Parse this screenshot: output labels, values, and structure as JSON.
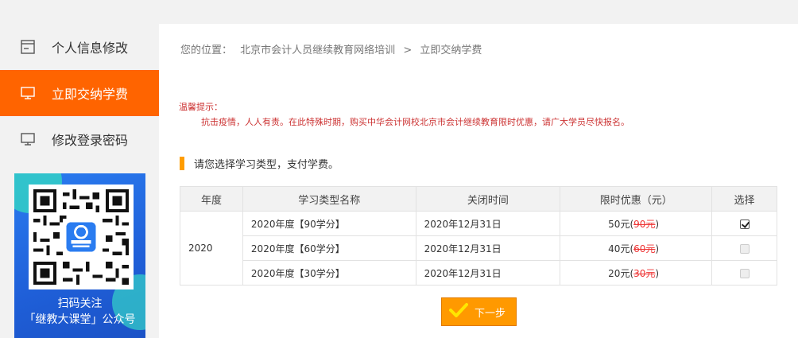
{
  "sidebar": {
    "items": [
      {
        "label": "个人信息修改",
        "icon": "profile-edit-icon",
        "active": false
      },
      {
        "label": "立即交纳学费",
        "icon": "monitor-icon",
        "active": true
      },
      {
        "label": "修改登录密码",
        "icon": "monitor-icon",
        "active": false
      }
    ],
    "qr": {
      "line1": "扫码关注",
      "line2": "「继教大课堂」公众号"
    }
  },
  "breadcrumb": {
    "prefix": "您的位置：",
    "site": "北京市会计人员继续教育网络培训",
    "separator": ">",
    "current": "立即交纳学费"
  },
  "notice": {
    "title": "温馨提示：",
    "body": "抗击疫情，人人有责。在此特殊时期，购买中华会计网校北京市会计继续教育限时优惠，请广大学员尽快报名。"
  },
  "section_title": "请您选择学习类型，支付学费。",
  "table": {
    "headers": [
      "年度",
      "学习类型名称",
      "关闭时间",
      "限时优惠（元）",
      "选择"
    ],
    "year": "2020",
    "rows": [
      {
        "name": "2020年度【90学分】",
        "close": "2020年12月31日",
        "price": "50元",
        "original": "90元",
        "selected": true
      },
      {
        "name": "2020年度【60学分】",
        "close": "2020年12月31日",
        "price": "40元",
        "original": "60元",
        "selected": false
      },
      {
        "name": "2020年度【30学分】",
        "close": "2020年12月31日",
        "price": "20元",
        "original": "30元",
        "selected": false
      }
    ]
  },
  "next_button": {
    "label": "下一步",
    "icon": "checkmark-icon"
  },
  "colors": {
    "accent": "#ff6400",
    "button": "#ff9900",
    "notice": "#cc3333",
    "qr_bg": "#1f5fd8"
  }
}
